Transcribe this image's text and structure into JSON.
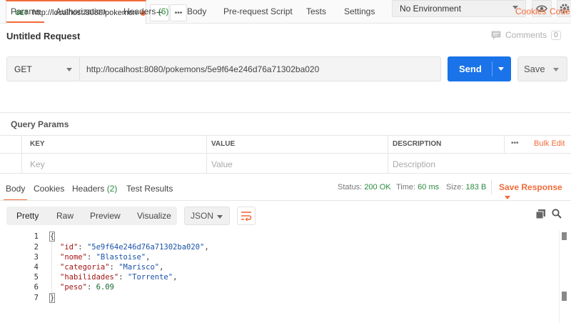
{
  "tabs": {
    "request_tab": {
      "method": "GET",
      "url": "http://localhost:8080/pokemons..."
    },
    "add_label": "+",
    "more_label": "•••"
  },
  "environment": {
    "selected": "No Environment"
  },
  "request": {
    "title": "Untitled Request",
    "comments_label": "Comments",
    "comments_count": "0",
    "method": "GET",
    "url": "http://localhost:8080/pokemons/5e9f64e246d76a71302ba020",
    "send_label": "Send",
    "save_label": "Save"
  },
  "request_tabs": {
    "params": "Params",
    "authorization": "Authorization",
    "headers": "Headers",
    "headers_count": "(6)",
    "body": "Body",
    "prerequest": "Pre-request Script",
    "tests": "Tests",
    "settings": "Settings",
    "cookies": "Cookies",
    "code": "Code"
  },
  "query_params": {
    "title": "Query Params",
    "columns": [
      "KEY",
      "VALUE",
      "DESCRIPTION"
    ],
    "more": "•••",
    "bulk_edit": "Bulk Edit",
    "placeholders": {
      "key": "Key",
      "value": "Value",
      "description": "Description"
    }
  },
  "response": {
    "tabs": {
      "body": "Body",
      "cookies": "Cookies",
      "headers": "Headers",
      "headers_count": "(2)",
      "test_results": "Test Results"
    },
    "status_label": "Status:",
    "status_value": "200 OK",
    "time_label": "Time:",
    "time_value": "60 ms",
    "size_label": "Size:",
    "size_value": "183 B",
    "save_response": "Save Response",
    "views": [
      "Pretty",
      "Raw",
      "Preview",
      "Visualize"
    ],
    "format": "JSON",
    "line_numbers": [
      "1",
      "2",
      "3",
      "4",
      "5",
      "6",
      "7"
    ],
    "json": {
      "open": "{",
      "close": "}",
      "fields": [
        {
          "key": "\"id\"",
          "value": "\"5e9f64e246d76a71302ba020\"",
          "type": "string",
          "comma": ","
        },
        {
          "key": "\"nome\"",
          "value": "\"Blastoise\"",
          "type": "string",
          "comma": ","
        },
        {
          "key": "\"categoria\"",
          "value": "\"Marisco\"",
          "type": "string",
          "comma": ","
        },
        {
          "key": "\"habilidades\"",
          "value": "\"Torrente\"",
          "type": "string",
          "comma": ","
        },
        {
          "key": "\"peso\"",
          "value": "6.09",
          "type": "number",
          "comma": ""
        }
      ]
    }
  },
  "colors": {
    "accent": "#f26b3a",
    "send_blue": "#1a73e8",
    "success": "#2b8a3e"
  },
  "icons": [
    "eye-icon",
    "gear-icon",
    "comment-icon",
    "wrap-lines-icon",
    "copy-icon",
    "search-icon"
  ]
}
